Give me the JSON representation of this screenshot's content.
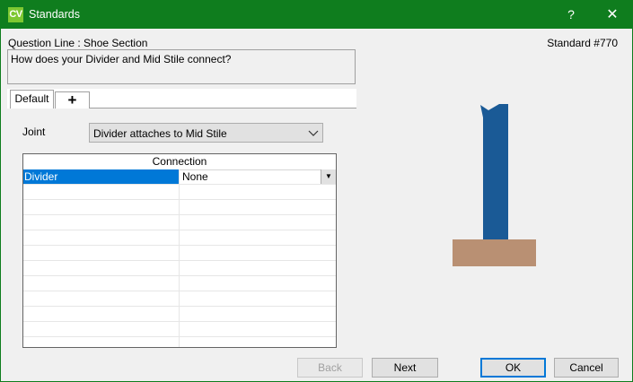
{
  "window": {
    "icon_text": "CV",
    "title": "Standards",
    "help_label": "?",
    "close_label": "✕"
  },
  "header": {
    "question_line": "Question Line : Shoe Section",
    "standard_number": "Standard #770"
  },
  "question": {
    "text": "How does your Divider and Mid Stile connect?"
  },
  "tabs": [
    {
      "label": "Default",
      "selected": true
    },
    {
      "label": "+",
      "selected": false
    }
  ],
  "joint": {
    "label": "Joint",
    "selected_value": "Divider attaches to Mid Stile",
    "arrow": "⌄"
  },
  "grid": {
    "header": "Connection",
    "rows": [
      {
        "name": "Divider",
        "value": "None",
        "dropdown_arrow": "▼"
      }
    ]
  },
  "buttons": {
    "back": "Back",
    "next": "Next",
    "ok": "OK",
    "cancel": "Cancel"
  },
  "colors": {
    "titlebar": "#0f7d1e",
    "selection": "#0078d7",
    "divider_shape": "#1a5a96",
    "shoe_shape": "#b99073"
  }
}
